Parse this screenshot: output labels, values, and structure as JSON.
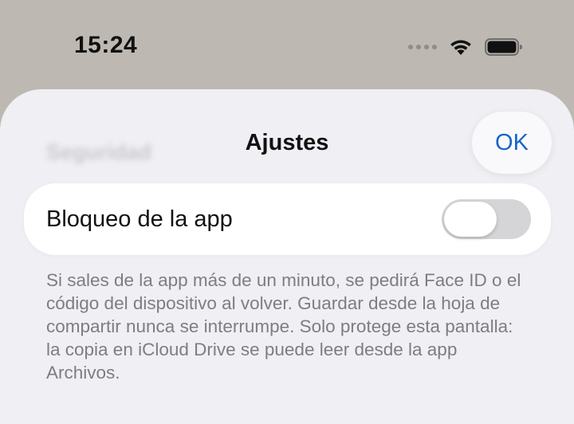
{
  "status_bar": {
    "time": "15:24",
    "icons": [
      "signal-dots-icon",
      "wifi-icon",
      "battery-icon"
    ]
  },
  "sheet": {
    "background_title": "Seguridad",
    "title": "Ajustes",
    "ok_label": "OK",
    "accent_color": "#1a64c8"
  },
  "settings": {
    "app_lock": {
      "label": "Bloqueo de la app",
      "enabled": false
    },
    "footnote": "Si sales de la app más de un minuto, se pedirá Face ID o el código del dispositivo al volver. Guardar desde la hoja de compartir nunca se interrumpe. Solo protege esta pantalla: la copia en iCloud Drive se puede leer desde la app Archivos."
  }
}
